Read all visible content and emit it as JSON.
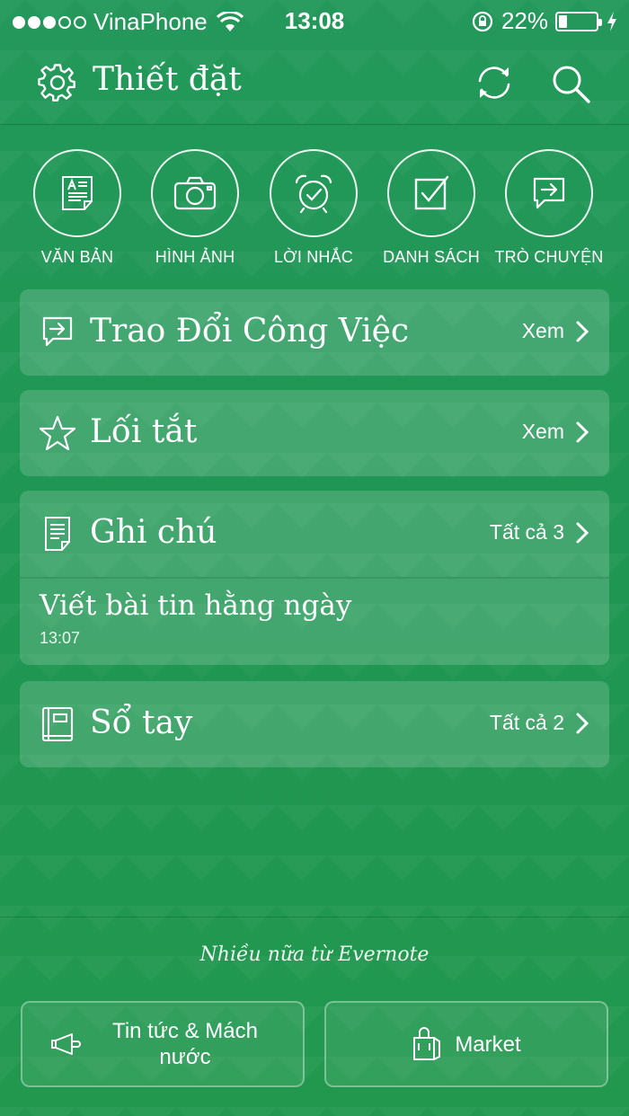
{
  "status_bar": {
    "carrier": "VinaPhone",
    "signal_bars": 3,
    "signal_bars_total": 5,
    "time": "13:08",
    "battery_percent": "22%",
    "battery_level": 0.22,
    "icons": [
      "signal-dots-icon",
      "wifi-icon",
      "rotation-lock-icon",
      "battery-icon",
      "charging-icon"
    ]
  },
  "header": {
    "title": "Thiết đặt",
    "icons": [
      "gear-icon",
      "sync-icon",
      "search-icon"
    ]
  },
  "quick_actions": [
    {
      "label": "VĂN BẢN",
      "icon": "text-note-icon"
    },
    {
      "label": "HÌNH ẢNH",
      "icon": "camera-icon"
    },
    {
      "label": "LỜI NHẮC",
      "icon": "alarm-clock-icon"
    },
    {
      "label": "DANH SÁCH",
      "icon": "checkbox-icon"
    },
    {
      "label": "TRÒ CHUYỆN",
      "icon": "chat-icon"
    }
  ],
  "sections": {
    "work_chat": {
      "title": "Trao Đổi Công Việc",
      "link": "Xem",
      "icon": "work-chat-icon"
    },
    "shortcuts": {
      "title": "Lối tắt",
      "link": "Xem",
      "icon": "star-icon"
    },
    "notes": {
      "title": "Ghi chú",
      "link": "Tất cả 3",
      "icon": "note-icon",
      "items": [
        {
          "title": "Viết bài tin hằng ngày",
          "time": "13:07"
        }
      ]
    },
    "notebooks": {
      "title": "Sổ tay",
      "link": "Tất cả 2",
      "icon": "notebook-icon"
    }
  },
  "footer": {
    "more_text": "Nhiều nữa từ Evernote",
    "buttons": [
      {
        "label": "Tin tức & Mách nước",
        "icon": "horn-icon"
      },
      {
        "label": "Market",
        "icon": "shopping-bag-icon"
      }
    ]
  },
  "colors": {
    "background": "#22964f",
    "card": "rgba(255,255,255,0.16)",
    "text": "#ffffff"
  }
}
